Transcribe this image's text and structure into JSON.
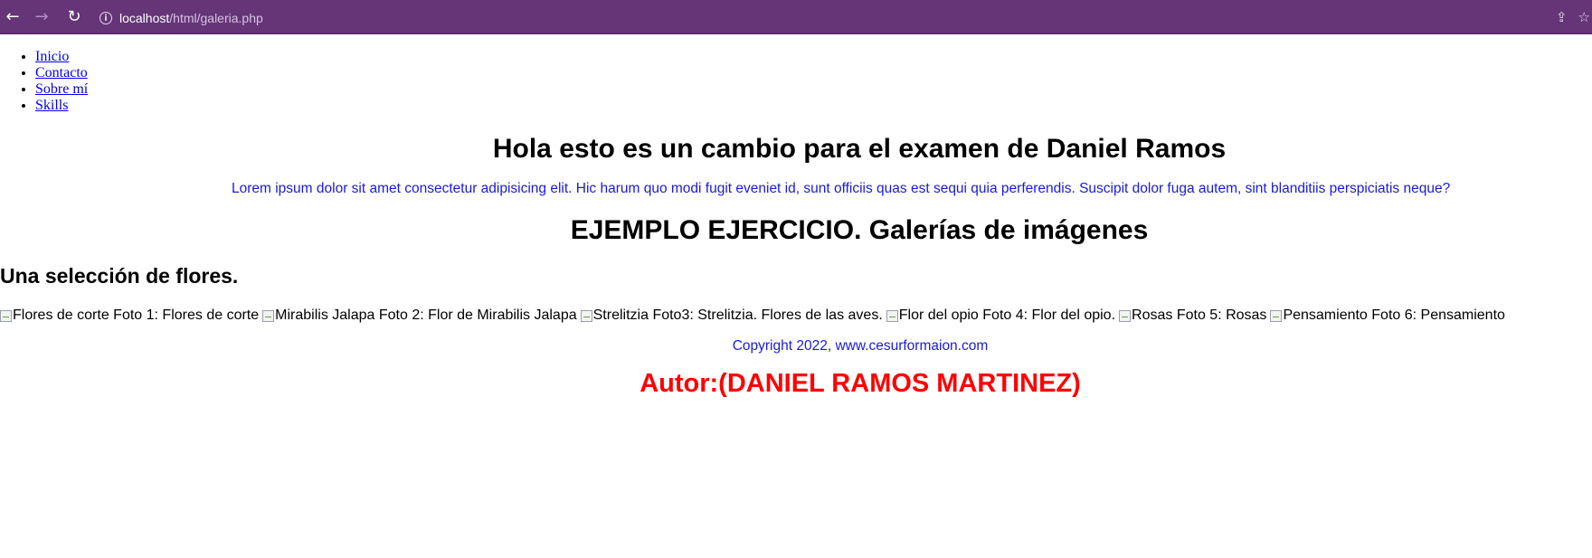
{
  "browser": {
    "url_host": "localhost",
    "url_path": "/html/galeria.php",
    "back_glyph": "←",
    "forward_glyph": "→",
    "reload_glyph": "↻",
    "info_glyph": "i",
    "share_glyph": "⇪",
    "star_glyph": "☆",
    "icons": [
      "back-icon",
      "forward-icon",
      "reload-icon",
      "info-icon",
      "share-icon",
      "star-icon"
    ],
    "toolbar_color": "#653578"
  },
  "nav": {
    "items": [
      {
        "label": "Inicio"
      },
      {
        "label": "Contacto"
      },
      {
        "label": "Sobre mí"
      },
      {
        "label": "Skills"
      }
    ]
  },
  "main": {
    "heading": "Hola esto es un cambio para el examen de Daniel Ramos",
    "lorem": "Lorem ipsum dolor sit amet consectetur adipisicing elit. Hic harum quo modi fugit eveniet id, sunt officiis quas est sequi quia perferendis. Suscipit dolor fuga autem, sint blanditiis perspiciatis neque?",
    "section_title": "EJEMPLO EJERCICIO. Galerías de imágenes",
    "subtitle": "Una selección de flores.",
    "gallery": [
      {
        "alt": "Flores de corte",
        "caption": "Foto 1: Flores de corte"
      },
      {
        "alt": "Mirabilis Jalapa",
        "caption": "Foto 2: Flor de Mirabilis Jalapa"
      },
      {
        "alt": "Strelitzia",
        "caption": "Foto3: Strelitzia. Flores de las aves."
      },
      {
        "alt": "Flor del opio",
        "caption": "Foto 4: Flor del opio."
      },
      {
        "alt": "Rosas",
        "caption": "Foto 5: Rosas"
      },
      {
        "alt": "Pensamiento",
        "caption": "Foto 6: Pensamiento"
      }
    ],
    "copyright": "Copyright 2022, www.cesurformaion.com",
    "autor": "Autor:(DANIEL RAMOS MARTINEZ)"
  },
  "colors": {
    "link": "#0000ee",
    "blue_text": "#1a1adb",
    "author_red": "#ff0000"
  }
}
